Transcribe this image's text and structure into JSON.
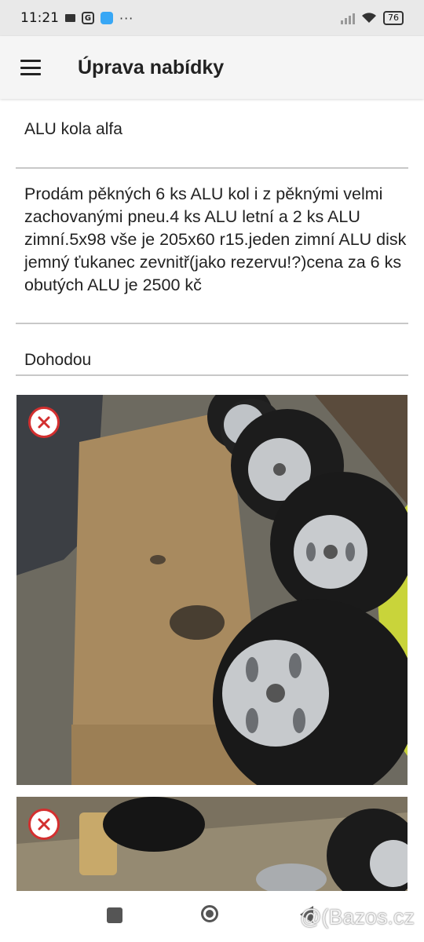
{
  "status_bar": {
    "time": "11:21",
    "g_icon_letter": "G",
    "overflow": "···",
    "battery": "76"
  },
  "app_bar": {
    "title": "Úprava nabídky"
  },
  "form": {
    "title": "ALU kola alfa",
    "description": "Prodám pěkných 6 ks ALU kol i z pěknými velmi zachovanými pneu.4 ks ALU letní a 2 ks ALU zimní.5x98 vše je 205x60 r15.jeden zimní ALU disk jemný ťukanec zevnitř(jako rezervu!?)cena za 6 ks obutých ALU je 2500 kč",
    "price": "Dohodou"
  },
  "photos": [
    {
      "subject": "alloy wheels with tires on wooden floor"
    },
    {
      "subject": "alloy wheel and helmet on wooden board"
    }
  ],
  "watermark": "@(Bazos.cz",
  "colors": {
    "remove_accent": "#d32f2f",
    "app_bar_bg": "#f5f5f5",
    "status_bar_bg": "#e9e9e9"
  }
}
